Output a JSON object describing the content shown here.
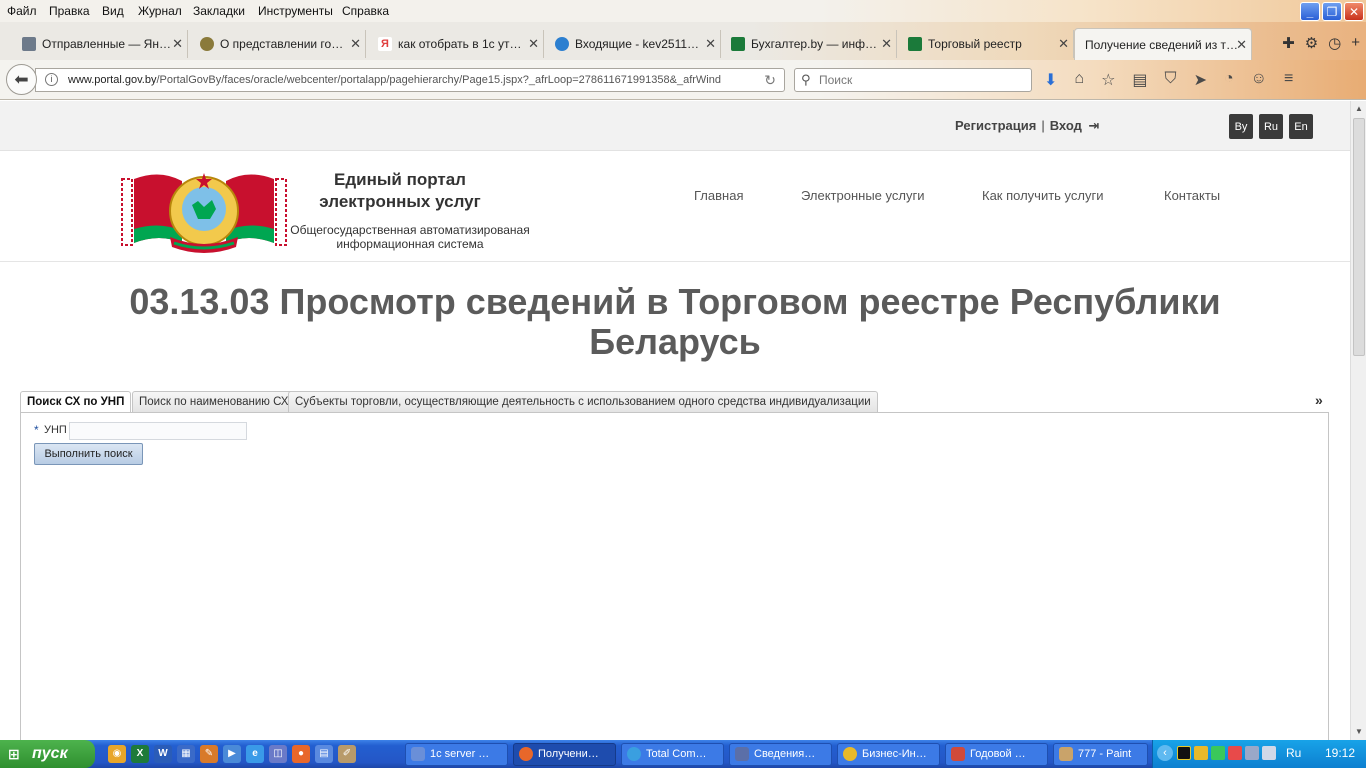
{
  "browser": {
    "menu": [
      "Файл",
      "Правка",
      "Вид",
      "Журнал",
      "Закладки",
      "Инструменты",
      "Справка"
    ],
    "tabs": [
      {
        "title": "Отправленные — Ян…",
        "icon": "mail-icon",
        "color": "#6d7a8a"
      },
      {
        "title": "О представлении го…",
        "icon": "emblem-icon",
        "color": "#8a7a3a"
      },
      {
        "title": "как отобрать в 1с ут…",
        "icon": "yandex-icon",
        "color": "#e04040"
      },
      {
        "title": "Входящие - kev2511…",
        "icon": "mailru-icon",
        "color": "#2c7fd0"
      },
      {
        "title": "Бухгалтер.by — инф…",
        "icon": "buhgalter-icon",
        "color": "#1b7a3a"
      },
      {
        "title": "Торговый реестр",
        "icon": "buhgalter-icon",
        "color": "#1b7a3a"
      },
      {
        "title": "Получение сведений из т…",
        "icon": "",
        "color": ""
      }
    ],
    "url_host": "www.portal.gov.by",
    "url_path": "/PortalGovBy/faces/oracle/webcenter/portalapp/pagehierarchy/Page15.jspx?_afrLoop=278611671991358&_afrWind",
    "search_placeholder": "Поиск"
  },
  "site": {
    "auth_register": "Регистрация",
    "auth_sep": "|",
    "auth_login": "Вход",
    "langs": [
      "By",
      "Ru",
      "En"
    ],
    "title_line1": "Единый портал",
    "title_line2": "электронных услуг",
    "subtitle_line1": "Общегосударственная автоматизированая",
    "subtitle_line2": "информационная система",
    "nav": [
      "Главная",
      "Электронные услуги",
      "Как получить услуги",
      "Контакты"
    ],
    "heading_line1": "03.13.03 Просмотр сведений в Торговом реестре Республики",
    "heading_line2": "Беларусь",
    "tabs": [
      "Поиск СХ по УНП",
      "Поиск по наименованию СХ",
      "Субъекты торговли, осуществляющие деятельность с использованием одного средства индивидуализации"
    ],
    "tabs_more": "»",
    "required_mark": "*",
    "unp_label": "УНП",
    "unp_value": "",
    "search_button": "Выполнить поиск"
  },
  "taskbar": {
    "start_label": "пуск",
    "tasks": [
      {
        "title": "1c server …",
        "color": "#6a8fd8"
      },
      {
        "title": "Получени…",
        "color": "#e8672a"
      },
      {
        "title": "Total Com…",
        "color": "#3a9fe0"
      },
      {
        "title": "Сведения…",
        "color": "#5b6fa8"
      },
      {
        "title": "Бизнес-Ин…",
        "color": "#e8b92a"
      },
      {
        "title": "Годовой …",
        "color": "#d04a3a"
      },
      {
        "title": "777 - Paint",
        "color": "#c9a36a"
      }
    ],
    "tray_lang": "Ru",
    "clock": "19:12"
  }
}
